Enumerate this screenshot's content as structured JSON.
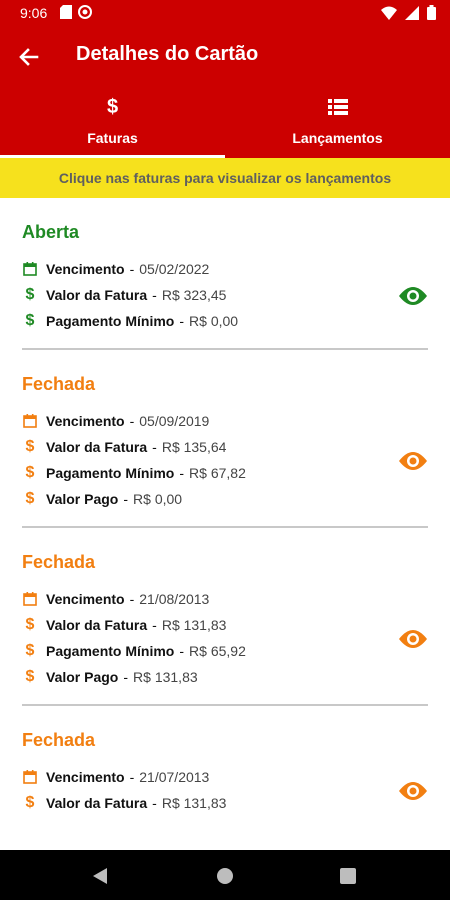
{
  "status": {
    "time": "9:06"
  },
  "header": {
    "title": "Detalhes do Cartão"
  },
  "tabs": [
    {
      "label": "Faturas",
      "icon": "dollar-icon",
      "active": true
    },
    {
      "label": "Lançamentos",
      "icon": "list-icon",
      "active": false
    }
  ],
  "banner": {
    "text": "Clique nas faturas para visualizar os lançamentos"
  },
  "colors": {
    "primary": "#cc0000",
    "banner": "#f6e11d",
    "open": "#1f8a24",
    "closed": "#f27f11"
  },
  "invoices": [
    {
      "status": "Aberta",
      "rows": [
        {
          "label": "Vencimento",
          "value": "05/02/2022",
          "icon": "calendar-icon"
        },
        {
          "label": "Valor da Fatura",
          "value": "R$ 323,45",
          "icon": "dollar-icon"
        },
        {
          "label": "Pagamento Mínimo",
          "value": "R$ 0,00",
          "icon": "dollar-icon"
        }
      ]
    },
    {
      "status": "Fechada",
      "rows": [
        {
          "label": "Vencimento",
          "value": "05/09/2019",
          "icon": "calendar-icon"
        },
        {
          "label": "Valor da Fatura",
          "value": "R$ 135,64",
          "icon": "dollar-icon"
        },
        {
          "label": "Pagamento Mínimo",
          "value": "R$ 67,82",
          "icon": "dollar-icon"
        },
        {
          "label": "Valor Pago",
          "value": "R$ 0,00",
          "icon": "dollar-icon"
        }
      ]
    },
    {
      "status": "Fechada",
      "rows": [
        {
          "label": "Vencimento",
          "value": "21/08/2013",
          "icon": "calendar-icon"
        },
        {
          "label": "Valor da Fatura",
          "value": "R$ 131,83",
          "icon": "dollar-icon"
        },
        {
          "label": "Pagamento Mínimo",
          "value": "R$ 65,92",
          "icon": "dollar-icon"
        },
        {
          "label": "Valor Pago",
          "value": "R$ 131,83",
          "icon": "dollar-icon"
        }
      ]
    },
    {
      "status": "Fechada",
      "rows": [
        {
          "label": "Vencimento",
          "value": "21/07/2013",
          "icon": "calendar-icon"
        },
        {
          "label": "Valor da Fatura",
          "value": "R$ 131,83",
          "icon": "dollar-icon"
        }
      ]
    }
  ]
}
